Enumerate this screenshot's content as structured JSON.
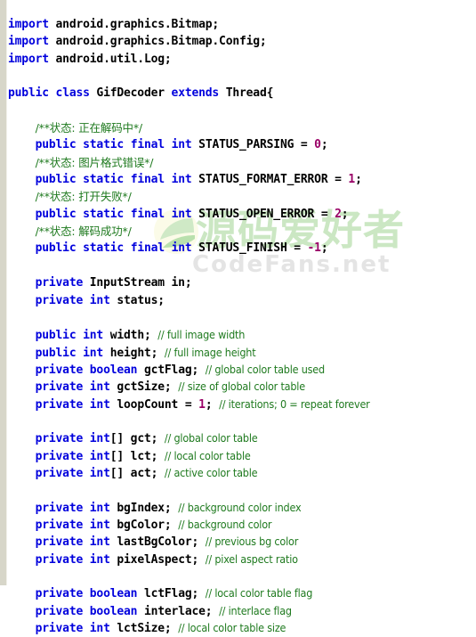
{
  "window": {
    "kind": "code-viewer",
    "language": "Java",
    "background_color": "#ffffff",
    "gutter_color": "#d7d6c9"
  },
  "colors": {
    "keyword": "#0000dd",
    "identifier": "#000000",
    "comment": "#1f7a1f",
    "number": "#990066",
    "watermark_green": "#cbe7c3",
    "watermark_gray": "#e4e4e4"
  },
  "watermark": {
    "logo_icon": "leaf-circle-icon",
    "chinese_text": "源码爱好者",
    "site_text": "CodeFans.net"
  },
  "code": {
    "lines": [
      [
        {
          "t": "import",
          "c": "kw"
        },
        {
          "t": " android.graphics.Bitmap;",
          "c": "txt"
        }
      ],
      [
        {
          "t": "import",
          "c": "kw"
        },
        {
          "t": " android.graphics.Bitmap.Config;",
          "c": "txt"
        }
      ],
      [
        {
          "t": "import",
          "c": "kw"
        },
        {
          "t": " android.util.Log;",
          "c": "txt"
        }
      ],
      [],
      [
        {
          "t": "public",
          "c": "kw"
        },
        {
          "t": " ",
          "c": "txt"
        },
        {
          "t": "class",
          "c": "kw"
        },
        {
          "t": " GifDecoder ",
          "c": "txt"
        },
        {
          "t": "extends",
          "c": "kw"
        },
        {
          "t": " Thread{",
          "c": "txt"
        }
      ],
      [],
      [
        {
          "t": "    ",
          "c": "txt"
        },
        {
          "t": "/**状态: 正在解码中*/",
          "c": "cmc"
        }
      ],
      [
        {
          "t": "    ",
          "c": "txt"
        },
        {
          "t": "public",
          "c": "kw"
        },
        {
          "t": " ",
          "c": "txt"
        },
        {
          "t": "static",
          "c": "kw"
        },
        {
          "t": " ",
          "c": "txt"
        },
        {
          "t": "final",
          "c": "kw"
        },
        {
          "t": " ",
          "c": "txt"
        },
        {
          "t": "int",
          "c": "kw"
        },
        {
          "t": " STATUS_PARSING = ",
          "c": "txt"
        },
        {
          "t": "0",
          "c": "num"
        },
        {
          "t": ";",
          "c": "txt"
        }
      ],
      [
        {
          "t": "    ",
          "c": "txt"
        },
        {
          "t": "/**状态: 图片格式错误*/",
          "c": "cmc"
        }
      ],
      [
        {
          "t": "    ",
          "c": "txt"
        },
        {
          "t": "public",
          "c": "kw"
        },
        {
          "t": " ",
          "c": "txt"
        },
        {
          "t": "static",
          "c": "kw"
        },
        {
          "t": " ",
          "c": "txt"
        },
        {
          "t": "final",
          "c": "kw"
        },
        {
          "t": " ",
          "c": "txt"
        },
        {
          "t": "int",
          "c": "kw"
        },
        {
          "t": " STATUS_FORMAT_ERROR = ",
          "c": "txt"
        },
        {
          "t": "1",
          "c": "num"
        },
        {
          "t": ";",
          "c": "txt"
        }
      ],
      [
        {
          "t": "    ",
          "c": "txt"
        },
        {
          "t": "/**状态: 打开失败*/",
          "c": "cmc"
        }
      ],
      [
        {
          "t": "    ",
          "c": "txt"
        },
        {
          "t": "public",
          "c": "kw"
        },
        {
          "t": " ",
          "c": "txt"
        },
        {
          "t": "static",
          "c": "kw"
        },
        {
          "t": " ",
          "c": "txt"
        },
        {
          "t": "final",
          "c": "kw"
        },
        {
          "t": " ",
          "c": "txt"
        },
        {
          "t": "int",
          "c": "kw"
        },
        {
          "t": " STATUS_OPEN_ERROR = ",
          "c": "txt"
        },
        {
          "t": "2",
          "c": "num"
        },
        {
          "t": ";",
          "c": "txt"
        }
      ],
      [
        {
          "t": "    ",
          "c": "txt"
        },
        {
          "t": "/**状态: 解码成功*/",
          "c": "cmc"
        }
      ],
      [
        {
          "t": "    ",
          "c": "txt"
        },
        {
          "t": "public",
          "c": "kw"
        },
        {
          "t": " ",
          "c": "txt"
        },
        {
          "t": "static",
          "c": "kw"
        },
        {
          "t": " ",
          "c": "txt"
        },
        {
          "t": "final",
          "c": "kw"
        },
        {
          "t": " ",
          "c": "txt"
        },
        {
          "t": "int",
          "c": "kw"
        },
        {
          "t": " STATUS_FINISH = ",
          "c": "txt"
        },
        {
          "t": "-1",
          "c": "num"
        },
        {
          "t": ";",
          "c": "txt"
        }
      ],
      [],
      [
        {
          "t": "    ",
          "c": "txt"
        },
        {
          "t": "private",
          "c": "kw"
        },
        {
          "t": " InputStream in;",
          "c": "txt"
        }
      ],
      [
        {
          "t": "    ",
          "c": "txt"
        },
        {
          "t": "private",
          "c": "kw"
        },
        {
          "t": " ",
          "c": "txt"
        },
        {
          "t": "int",
          "c": "kw"
        },
        {
          "t": " status;",
          "c": "txt"
        }
      ],
      [],
      [
        {
          "t": "    ",
          "c": "txt"
        },
        {
          "t": "public",
          "c": "kw"
        },
        {
          "t": " ",
          "c": "txt"
        },
        {
          "t": "int",
          "c": "kw"
        },
        {
          "t": " width; ",
          "c": "txt"
        },
        {
          "t": "// full image width",
          "c": "cm"
        }
      ],
      [
        {
          "t": "    ",
          "c": "txt"
        },
        {
          "t": "public",
          "c": "kw"
        },
        {
          "t": " ",
          "c": "txt"
        },
        {
          "t": "int",
          "c": "kw"
        },
        {
          "t": " height; ",
          "c": "txt"
        },
        {
          "t": "// full image height",
          "c": "cm"
        }
      ],
      [
        {
          "t": "    ",
          "c": "txt"
        },
        {
          "t": "private",
          "c": "kw"
        },
        {
          "t": " ",
          "c": "txt"
        },
        {
          "t": "boolean",
          "c": "kw"
        },
        {
          "t": " gctFlag; ",
          "c": "txt"
        },
        {
          "t": "// global color table used",
          "c": "cm"
        }
      ],
      [
        {
          "t": "    ",
          "c": "txt"
        },
        {
          "t": "private",
          "c": "kw"
        },
        {
          "t": " ",
          "c": "txt"
        },
        {
          "t": "int",
          "c": "kw"
        },
        {
          "t": " gctSize; ",
          "c": "txt"
        },
        {
          "t": "// size of global color table",
          "c": "cm"
        }
      ],
      [
        {
          "t": "    ",
          "c": "txt"
        },
        {
          "t": "private",
          "c": "kw"
        },
        {
          "t": " ",
          "c": "txt"
        },
        {
          "t": "int",
          "c": "kw"
        },
        {
          "t": " loopCount = ",
          "c": "txt"
        },
        {
          "t": "1",
          "c": "num"
        },
        {
          "t": "; ",
          "c": "txt"
        },
        {
          "t": "// iterations; 0 = repeat forever",
          "c": "cm"
        }
      ],
      [],
      [
        {
          "t": "    ",
          "c": "txt"
        },
        {
          "t": "private",
          "c": "kw"
        },
        {
          "t": " ",
          "c": "txt"
        },
        {
          "t": "int",
          "c": "kw"
        },
        {
          "t": "[] gct; ",
          "c": "txt"
        },
        {
          "t": "// global color table",
          "c": "cm"
        }
      ],
      [
        {
          "t": "    ",
          "c": "txt"
        },
        {
          "t": "private",
          "c": "kw"
        },
        {
          "t": " ",
          "c": "txt"
        },
        {
          "t": "int",
          "c": "kw"
        },
        {
          "t": "[] lct; ",
          "c": "txt"
        },
        {
          "t": "// local color table",
          "c": "cm"
        }
      ],
      [
        {
          "t": "    ",
          "c": "txt"
        },
        {
          "t": "private",
          "c": "kw"
        },
        {
          "t": " ",
          "c": "txt"
        },
        {
          "t": "int",
          "c": "kw"
        },
        {
          "t": "[] act; ",
          "c": "txt"
        },
        {
          "t": "// active color table",
          "c": "cm"
        }
      ],
      [],
      [
        {
          "t": "    ",
          "c": "txt"
        },
        {
          "t": "private",
          "c": "kw"
        },
        {
          "t": " ",
          "c": "txt"
        },
        {
          "t": "int",
          "c": "kw"
        },
        {
          "t": " bgIndex; ",
          "c": "txt"
        },
        {
          "t": "// background color index",
          "c": "cm"
        }
      ],
      [
        {
          "t": "    ",
          "c": "txt"
        },
        {
          "t": "private",
          "c": "kw"
        },
        {
          "t": " ",
          "c": "txt"
        },
        {
          "t": "int",
          "c": "kw"
        },
        {
          "t": " bgColor; ",
          "c": "txt"
        },
        {
          "t": "// background color",
          "c": "cm"
        }
      ],
      [
        {
          "t": "    ",
          "c": "txt"
        },
        {
          "t": "private",
          "c": "kw"
        },
        {
          "t": " ",
          "c": "txt"
        },
        {
          "t": "int",
          "c": "kw"
        },
        {
          "t": " lastBgColor; ",
          "c": "txt"
        },
        {
          "t": "// previous bg color",
          "c": "cm"
        }
      ],
      [
        {
          "t": "    ",
          "c": "txt"
        },
        {
          "t": "private",
          "c": "kw"
        },
        {
          "t": " ",
          "c": "txt"
        },
        {
          "t": "int",
          "c": "kw"
        },
        {
          "t": " pixelAspect; ",
          "c": "txt"
        },
        {
          "t": "// pixel aspect ratio",
          "c": "cm"
        }
      ],
      [],
      [
        {
          "t": "    ",
          "c": "txt"
        },
        {
          "t": "private",
          "c": "kw"
        },
        {
          "t": " ",
          "c": "txt"
        },
        {
          "t": "boolean",
          "c": "kw"
        },
        {
          "t": " lctFlag; ",
          "c": "txt"
        },
        {
          "t": "// local color table flag",
          "c": "cm"
        }
      ],
      [
        {
          "t": "    ",
          "c": "txt"
        },
        {
          "t": "private",
          "c": "kw"
        },
        {
          "t": " ",
          "c": "txt"
        },
        {
          "t": "boolean",
          "c": "kw"
        },
        {
          "t": " interlace; ",
          "c": "txt"
        },
        {
          "t": "// interlace flag",
          "c": "cm"
        }
      ],
      [
        {
          "t": "    ",
          "c": "txt"
        },
        {
          "t": "private",
          "c": "kw"
        },
        {
          "t": " ",
          "c": "txt"
        },
        {
          "t": "int",
          "c": "kw"
        },
        {
          "t": " lctSize; ",
          "c": "txt"
        },
        {
          "t": "// local color table size",
          "c": "cm"
        }
      ]
    ]
  }
}
